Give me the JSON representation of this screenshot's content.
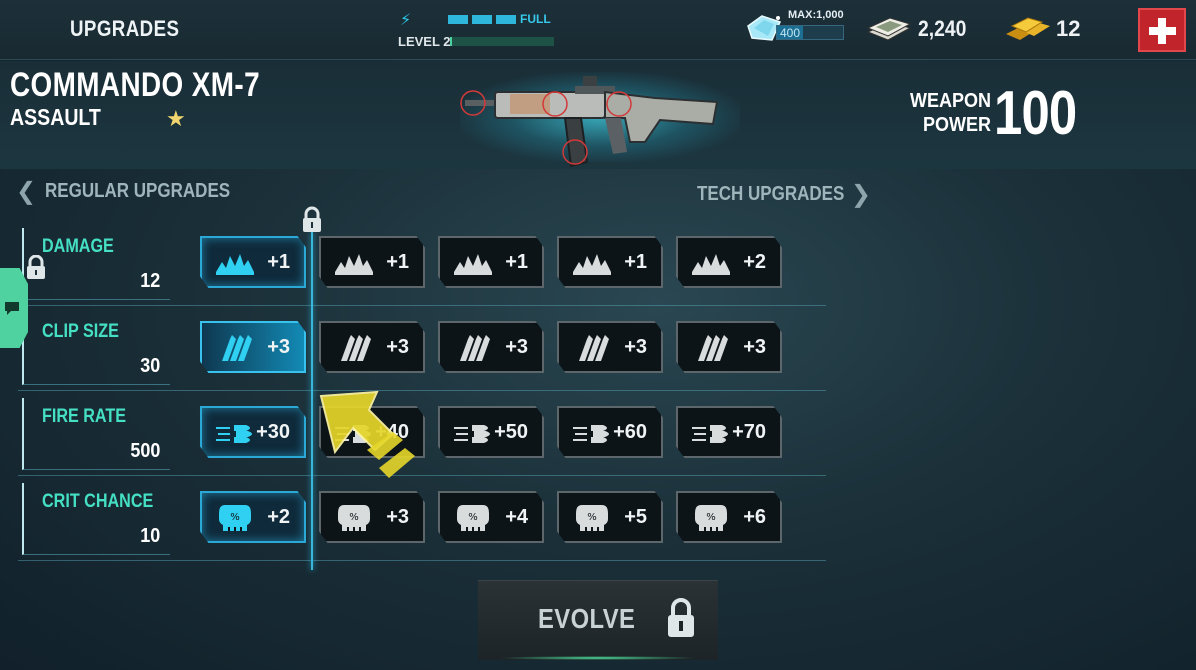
{
  "topbar": {
    "title": "UPGRADES",
    "energy": {
      "segments_filled": 3,
      "segments_total": 3,
      "status": "FULL"
    },
    "level": {
      "label": "LEVEL 2",
      "progress": 0.02
    },
    "diamonds": {
      "max_label": "MAX:1,000",
      "value": "400",
      "fraction": 0.4
    },
    "cash": "2,240",
    "gold": "12",
    "add_button": "add-currency"
  },
  "weapon": {
    "name": "COMMANDO XM-7",
    "class": "ASSAULT",
    "stars": 1,
    "power_label_line1": "WEAPON",
    "power_label_line2": "POWER",
    "power_value": "100"
  },
  "nav": {
    "left_label": "REGULAR UPGRADES",
    "right_label": "TECH UPGRADES"
  },
  "stats": [
    {
      "name": "DAMAGE",
      "value": "12",
      "icon": "explosion-icon",
      "upgrades": [
        "+1",
        "+1",
        "+1",
        "+1",
        "+2"
      ],
      "states": [
        "active",
        "locked",
        "locked",
        "locked",
        "locked"
      ]
    },
    {
      "name": "CLIP SIZE",
      "value": "30",
      "icon": "bullets-icon",
      "upgrades": [
        "+3",
        "+3",
        "+3",
        "+3",
        "+3"
      ],
      "states": [
        "glow",
        "locked",
        "locked",
        "locked",
        "locked"
      ]
    },
    {
      "name": "FIRE RATE",
      "value": "500",
      "icon": "speed-bullet-icon",
      "upgrades": [
        "+30",
        "+40",
        "+50",
        "+60",
        "+70"
      ],
      "states": [
        "active",
        "locked",
        "locked",
        "locked",
        "locked"
      ]
    },
    {
      "name": "CRIT CHANCE",
      "value": "10",
      "icon": "skull-icon",
      "upgrades": [
        "+2",
        "+3",
        "+4",
        "+5",
        "+6"
      ],
      "states": [
        "active",
        "locked",
        "locked",
        "locked",
        "locked"
      ]
    }
  ],
  "evolve": {
    "label": "EVOLVE",
    "locked": true
  },
  "colors": {
    "accent_cyan": "#2ba8d6",
    "stat_green": "#45e0c4",
    "danger_red": "#c1252b",
    "hint_yellow": "#e6d62a"
  }
}
